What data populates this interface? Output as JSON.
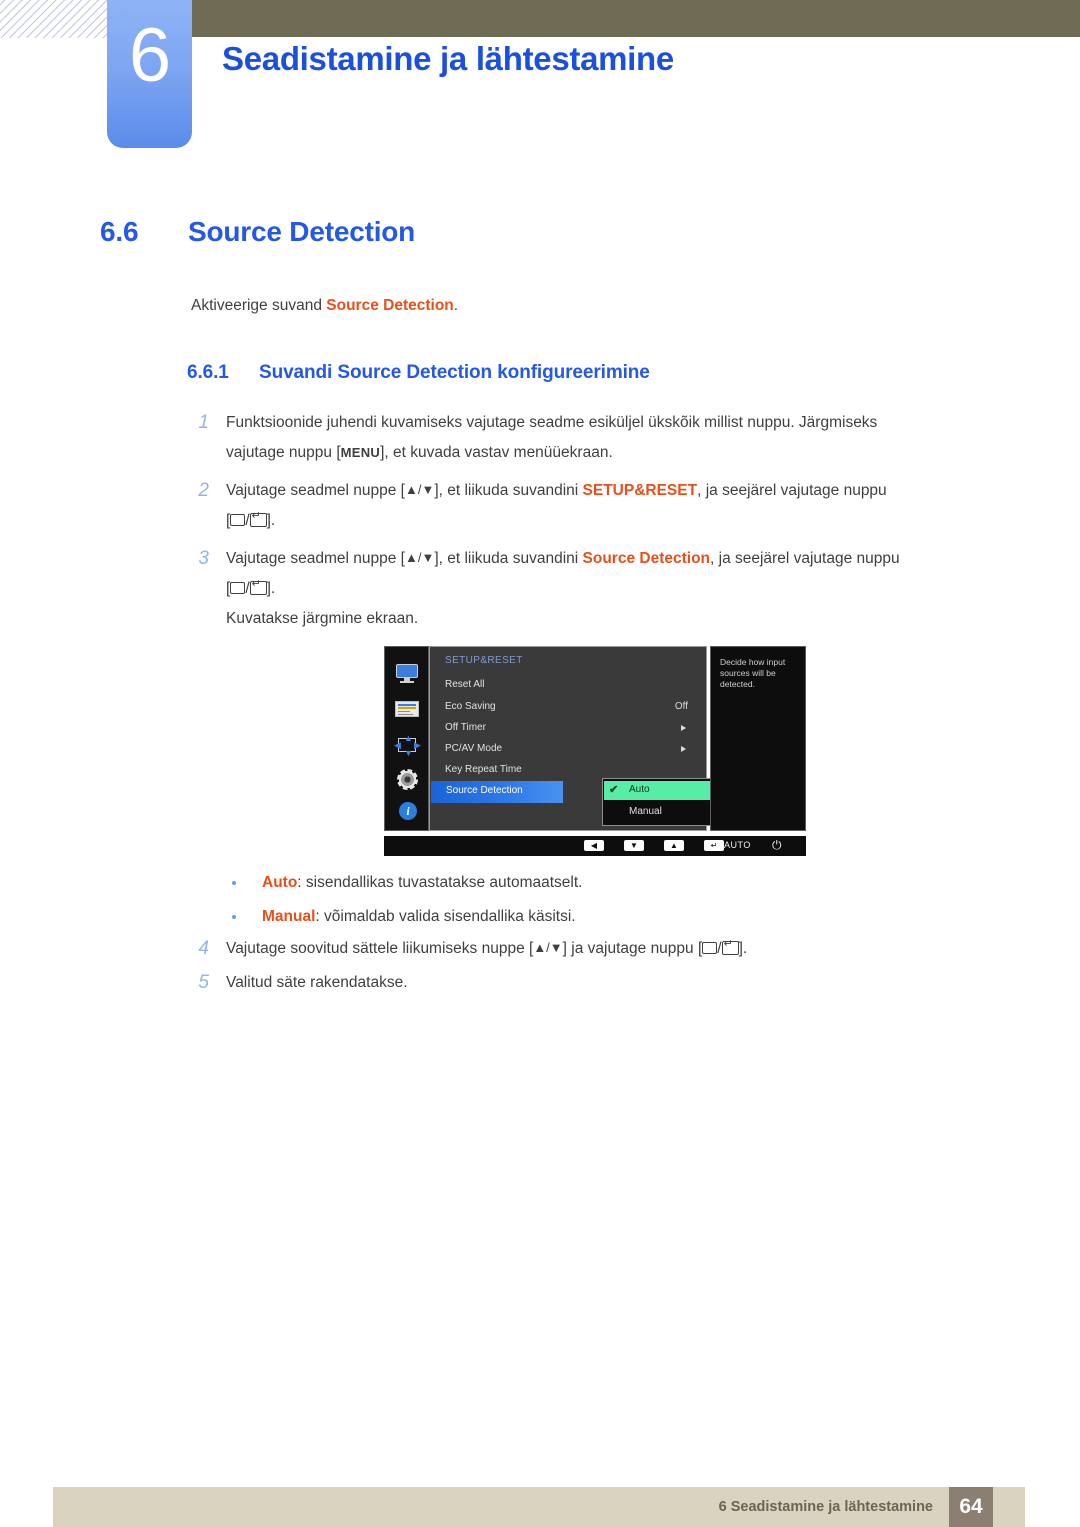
{
  "chapter": {
    "number": "6",
    "title": "Seadistamine ja lähtestamine"
  },
  "section": {
    "number": "6.6",
    "title": "Source Detection"
  },
  "intro": {
    "before": "Aktiveerige suvand ",
    "highlight": "Source Detection",
    "after": "."
  },
  "subsection": {
    "number": "6.6.1",
    "title": "Suvandi Source Detection konfigureerimine"
  },
  "steps": [
    {
      "n": "1",
      "line1_a": "Funktsioonide juhendi kuvamiseks vajutage seadme esiküljel ükskõik millist nuppu. Järgmiseks",
      "line2_a": "vajutage nuppu [",
      "key": "MENU",
      "line2_b": "], et kuvada vastav menüüekraan."
    },
    {
      "n": "2",
      "a": "Vajutage seadmel nuppe [",
      "updown": "▲/▼",
      "b": "], et liikuda suvandini ",
      "highlight": "SETUP&RESET",
      "c": ", ja seejärel vajutage nuppu",
      "d": "[",
      "e": "].",
      "slash": "/"
    },
    {
      "n": "3",
      "a": "Vajutage seadmel nuppe [",
      "updown": "▲/▼",
      "b": "], et liikuda suvandini ",
      "highlight": "Source Detection",
      "c": ", ja seejärel vajutage nuppu",
      "d": "[",
      "e": "].",
      "slash": "/",
      "extra": "Kuvatakse järgmine ekraan."
    }
  ],
  "osd": {
    "menu_title": "SETUP&RESET",
    "rows": [
      {
        "label": "Reset All",
        "value": "",
        "arrow": false
      },
      {
        "label": "Eco Saving",
        "value": "Off",
        "arrow": false
      },
      {
        "label": "Off Timer",
        "value": "",
        "arrow": true
      },
      {
        "label": "PC/AV Mode",
        "value": "",
        "arrow": true
      },
      {
        "label": "Key Repeat Time",
        "value": "",
        "arrow": false
      },
      {
        "label": "Source Detection",
        "value": "",
        "arrow": false,
        "selected": true
      }
    ],
    "submenu": [
      {
        "label": "Auto",
        "checked": true
      },
      {
        "label": "Manual",
        "checked": false
      }
    ],
    "help_text": "Decide how input sources will be detected.",
    "sidebar_icons": [
      "monitor-icon",
      "color-bars-icon",
      "position-arrows-icon",
      "gear-icon",
      "info-icon"
    ],
    "bottom_bar": {
      "left_arrow": "◀",
      "down_arrow": "▼",
      "up_arrow": "▲",
      "enter": "↵",
      "auto_label": "AUTO",
      "power": "⏻"
    },
    "colors": {
      "selected_row": "#2f7ae8",
      "submenu_highlight": "#56eda6",
      "panel_bg": "#3a3a3a",
      "sidebar_bg": "#111111"
    }
  },
  "bullets": [
    {
      "term": "Auto",
      "rest": ": sisendallikas tuvastatakse automaatselt."
    },
    {
      "term": "Manual",
      "rest": ": võimaldab valida sisendallika käsitsi."
    }
  ],
  "steps_tail": [
    {
      "n": "4",
      "a": "Vajutage soovitud sättele liikumiseks nuppe [",
      "updown": "▲/▼",
      "b": "] ja vajutage nuppu [",
      "slash": "/",
      "c": "]."
    },
    {
      "n": "5",
      "a": "Valitud säte rakendatakse."
    }
  ],
  "footer": {
    "text": "6 Seadistamine ja lähtestamine",
    "page": "64"
  },
  "theme": {
    "heading_blue": "#2358e8",
    "accent_orange": "#e8501a",
    "band_olive": "#6e6a53",
    "tab_blue": "#7ea6f2",
    "footer_band": "#d9d3c0",
    "footer_page_box": "#8a7f70"
  }
}
